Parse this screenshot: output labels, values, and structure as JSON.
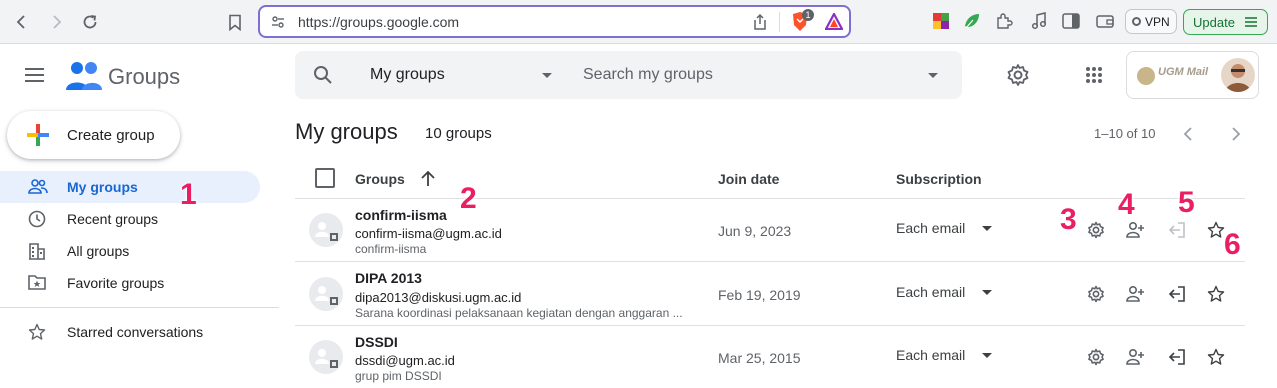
{
  "browser": {
    "url": "https://groups.google.com",
    "brave_badge": "1",
    "vpn_label": "VPN",
    "update_label": "Update"
  },
  "app": {
    "name": "Groups",
    "account_logo_text": "UGM Mail"
  },
  "search": {
    "scope": "My groups",
    "placeholder": "Search my groups"
  },
  "sidebar": {
    "create_label": "Create group",
    "items": [
      {
        "label": "My groups",
        "icon": "people-icon",
        "active": true
      },
      {
        "label": "Recent groups",
        "icon": "clock-icon"
      },
      {
        "label": "All groups",
        "icon": "building-icon"
      },
      {
        "label": "Favorite groups",
        "icon": "star-folder-icon"
      }
    ],
    "starred_label": "Starred conversations"
  },
  "main": {
    "title": "My groups",
    "count": "10 groups",
    "pager": "1–10 of 10",
    "columns": {
      "groups": "Groups",
      "join_date": "Join date",
      "subscription": "Subscription"
    },
    "rows": [
      {
        "name": "confirm-iisma",
        "email": "confirm-iisma@ugm.ac.id",
        "desc": "confirm-iisma",
        "join_date": "Jun 9, 2023",
        "subscription": "Each email"
      },
      {
        "name": "DIPA 2013",
        "email": "dipa2013@diskusi.ugm.ac.id",
        "desc": "Sarana koordinasi pelaksanaan kegiatan dengan anggaran ...",
        "join_date": "Feb 19, 2019",
        "subscription": "Each email"
      },
      {
        "name": "DSSDI",
        "email": "dssdi@ugm.ac.id",
        "desc": "grup pim DSSDI",
        "join_date": "Mar 25, 2015",
        "subscription": "Each email"
      }
    ]
  },
  "annotations": [
    "1",
    "2",
    "3",
    "4",
    "5",
    "6"
  ],
  "colors": {
    "accent": "#1967d2",
    "active_bg": "#e8f0fe",
    "annotation": "#e91e63",
    "url_border": "#7e6fd0"
  }
}
